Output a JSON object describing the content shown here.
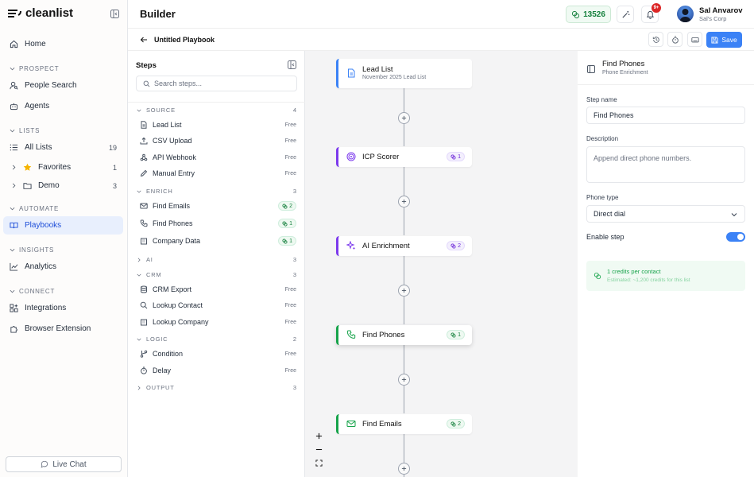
{
  "app": {
    "logo_text": "cleanlist"
  },
  "nav": {
    "home": "Home",
    "sections": {
      "prospect": "PROSPECT",
      "lists": "LISTS",
      "automate": "AUTOMATE",
      "insights": "INSIGHTS",
      "connect": "CONNECT"
    },
    "people_search": "People Search",
    "agents": "Agents",
    "all_lists": {
      "label": "All Lists",
      "count": "19"
    },
    "favorites": {
      "label": "Favorites",
      "count": "1"
    },
    "demo": {
      "label": "Demo",
      "count": "3"
    },
    "playbooks": "Playbooks",
    "analytics": "Analytics",
    "integrations": "Integrations",
    "browser_extension": "Browser Extension",
    "live_chat": "Live Chat"
  },
  "header": {
    "title": "Builder",
    "credits": "13526",
    "notif_badge": "9+",
    "user_name": "Sal Anvarov",
    "user_org": "Sal's Corp"
  },
  "toolbar": {
    "playbook_name": "Untitled Playbook",
    "save_label": "Save"
  },
  "steps_panel": {
    "title": "Steps",
    "search_placeholder": "Search steps...",
    "categories": {
      "source": {
        "label": "SOURCE",
        "count": "4"
      },
      "enrich": {
        "label": "ENRICH",
        "count": "3"
      },
      "ai": {
        "label": "AI",
        "count": "3"
      },
      "crm": {
        "label": "CRM",
        "count": "3"
      },
      "logic": {
        "label": "LOGIC",
        "count": "2"
      },
      "output": {
        "label": "OUTPUT",
        "count": "3"
      }
    },
    "free_label": "Free",
    "items": {
      "lead_list": "Lead List",
      "csv_upload": "CSV Upload",
      "api_webhook": "API Webhook",
      "manual_entry": "Manual Entry",
      "find_emails": {
        "label": "Find Emails",
        "credits": "2"
      },
      "find_phones": {
        "label": "Find Phones",
        "credits": "1"
      },
      "company_data": {
        "label": "Company Data",
        "credits": "1"
      },
      "crm_export": "CRM Export",
      "lookup_contact": "Lookup Contact",
      "lookup_company": "Lookup Company",
      "condition": "Condition",
      "delay": "Delay"
    }
  },
  "canvas": {
    "nodes": {
      "lead_list": {
        "title": "Lead List",
        "subtitle": "November 2025 Lead List",
        "color": "#3b82f6"
      },
      "icp_scorer": {
        "title": "ICP Scorer",
        "credits": "1",
        "color": "#7c3aed"
      },
      "ai_enrichment": {
        "title": "AI Enrichment",
        "credits": "2",
        "color": "#7c3aed"
      },
      "find_phones": {
        "title": "Find Phones",
        "credits": "1",
        "color": "#16a34a"
      },
      "find_emails": {
        "title": "Find Emails",
        "credits": "2",
        "color": "#16a34a"
      }
    }
  },
  "detail": {
    "title": "Find Phones",
    "subtitle": "Phone Enrichment",
    "step_name_label": "Step name",
    "step_name_value": "Find Phones",
    "description_label": "Description",
    "description_placeholder": "Append direct phone numbers.",
    "phone_type_label": "Phone type",
    "phone_type_value": "Direct dial",
    "enable_label": "Enable step",
    "enabled": true,
    "credits_text": "1 credits per contact",
    "estimate_text": "Estimated: ~1,200 credits for this list"
  },
  "colors": {
    "accent": "#3b82f6",
    "green": "#16a34a",
    "purple": "#7c3aed"
  }
}
